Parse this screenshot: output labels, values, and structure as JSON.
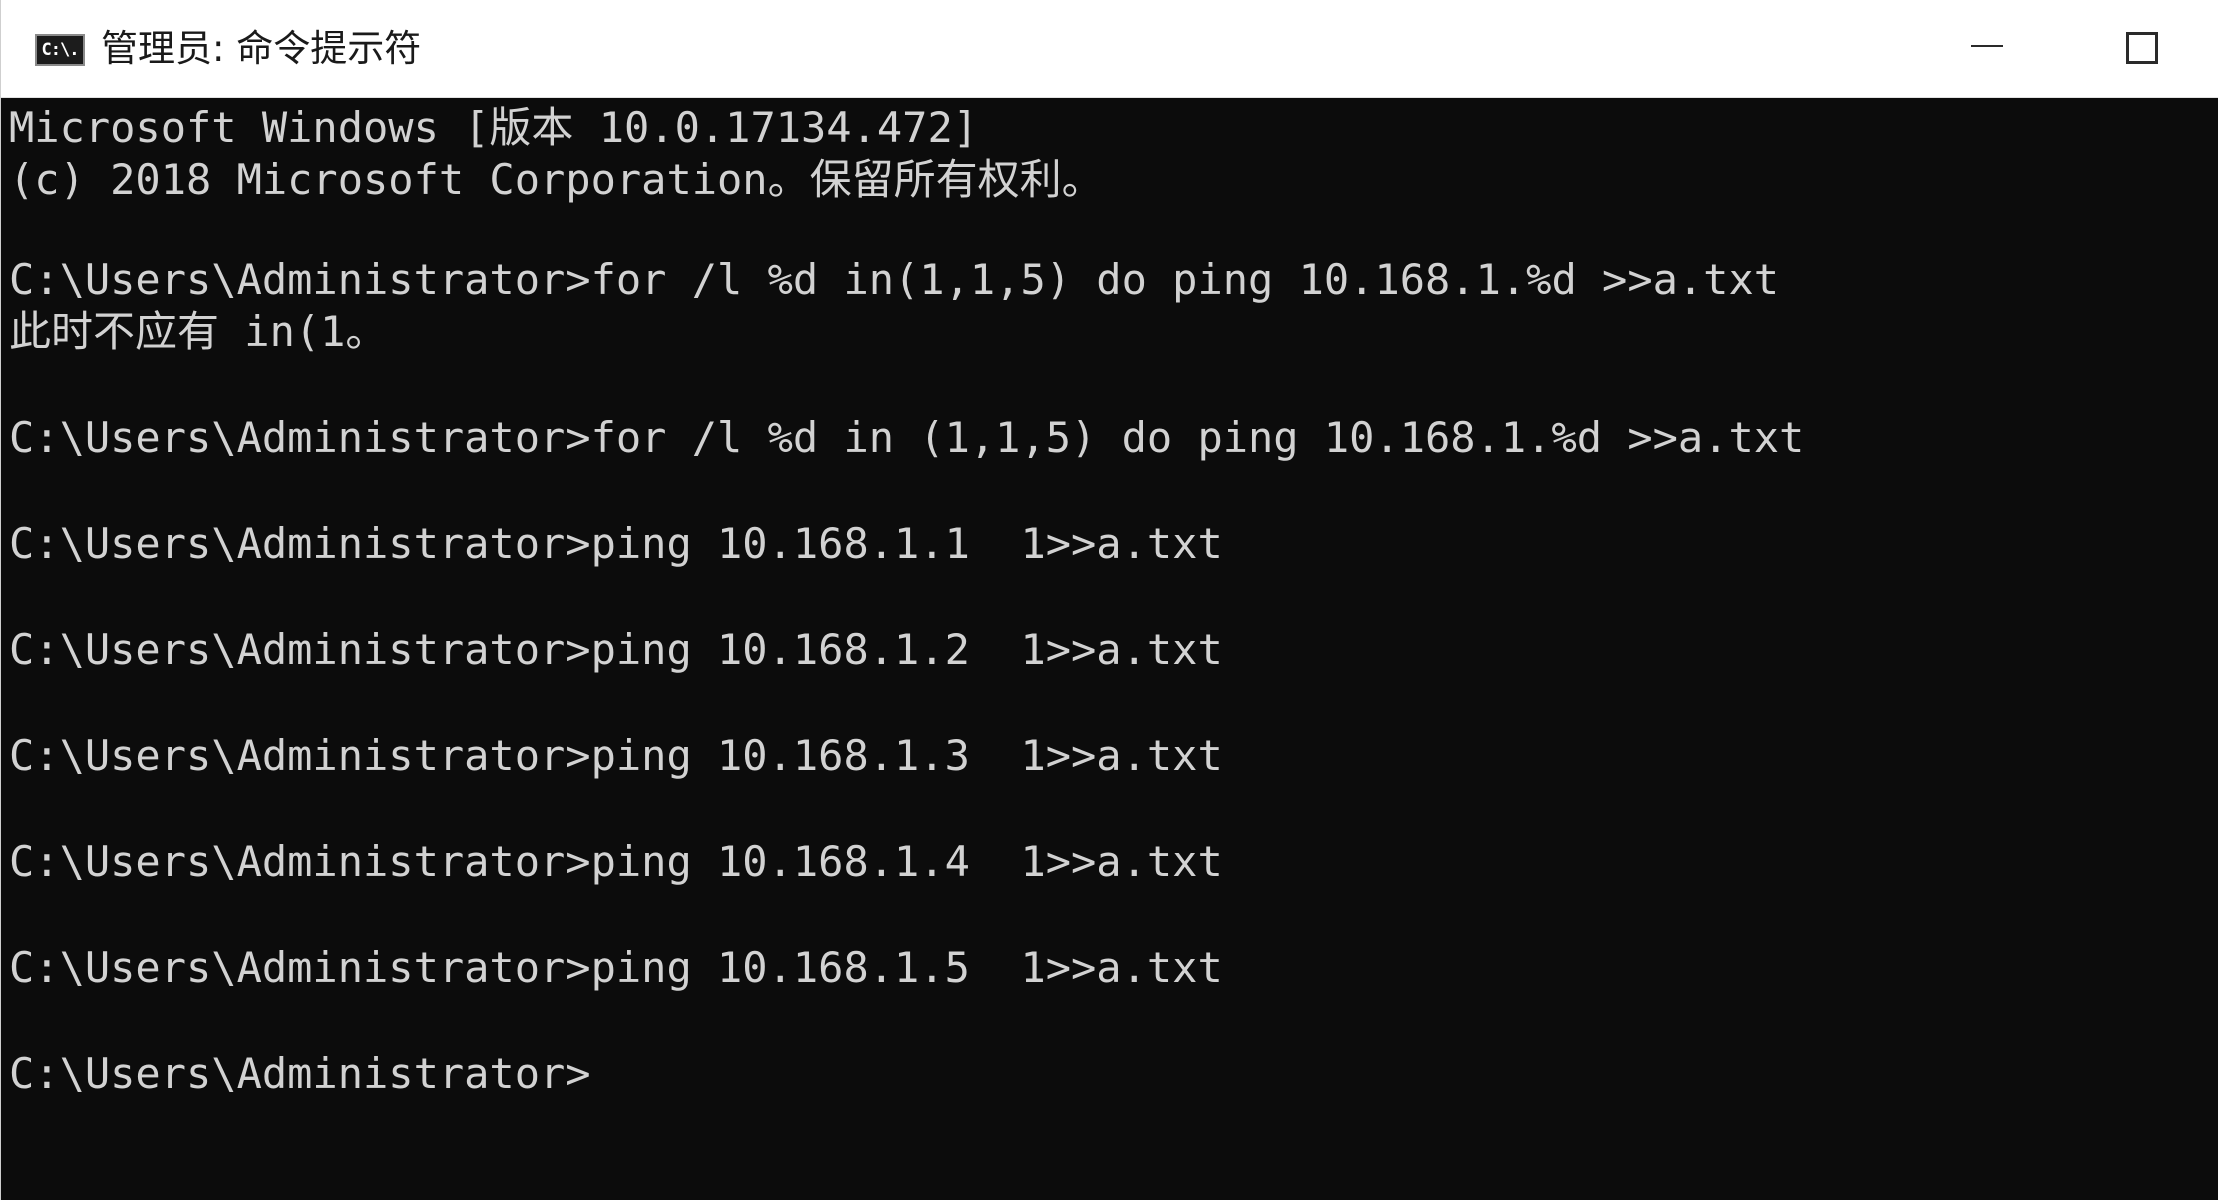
{
  "window": {
    "title": "管理员: 命令提示符",
    "icon": "cmd-icon",
    "icon_label": "C:\\."
  },
  "controls": {
    "minimize_icon": "minimize-icon",
    "maximize_icon": "maximize-icon"
  },
  "console": {
    "background": "#0c0c0c",
    "foreground": "#d2d2d2",
    "lines": [
      "Microsoft Windows [版本 10.0.17134.472]",
      "(c) 2018 Microsoft Corporation。保留所有权利。",
      "C:\\Users\\Administrator>for /l %d in(1,1,5) do ping 10.168.1.%d >>a.txt",
      "此时不应有 in(1。",
      "C:\\Users\\Administrator>for /l %d in (1,1,5) do ping 10.168.1.%d >>a.txt",
      "C:\\Users\\Administrator>ping 10.168.1.1  1>>a.txt",
      "C:\\Users\\Administrator>ping 10.168.1.2  1>>a.txt",
      "C:\\Users\\Administrator>ping 10.168.1.3  1>>a.txt",
      "C:\\Users\\Administrator>ping 10.168.1.4  1>>a.txt",
      "C:\\Users\\Administrator>ping 10.168.1.5  1>>a.txt",
      "C:\\Users\\Administrator>"
    ]
  }
}
